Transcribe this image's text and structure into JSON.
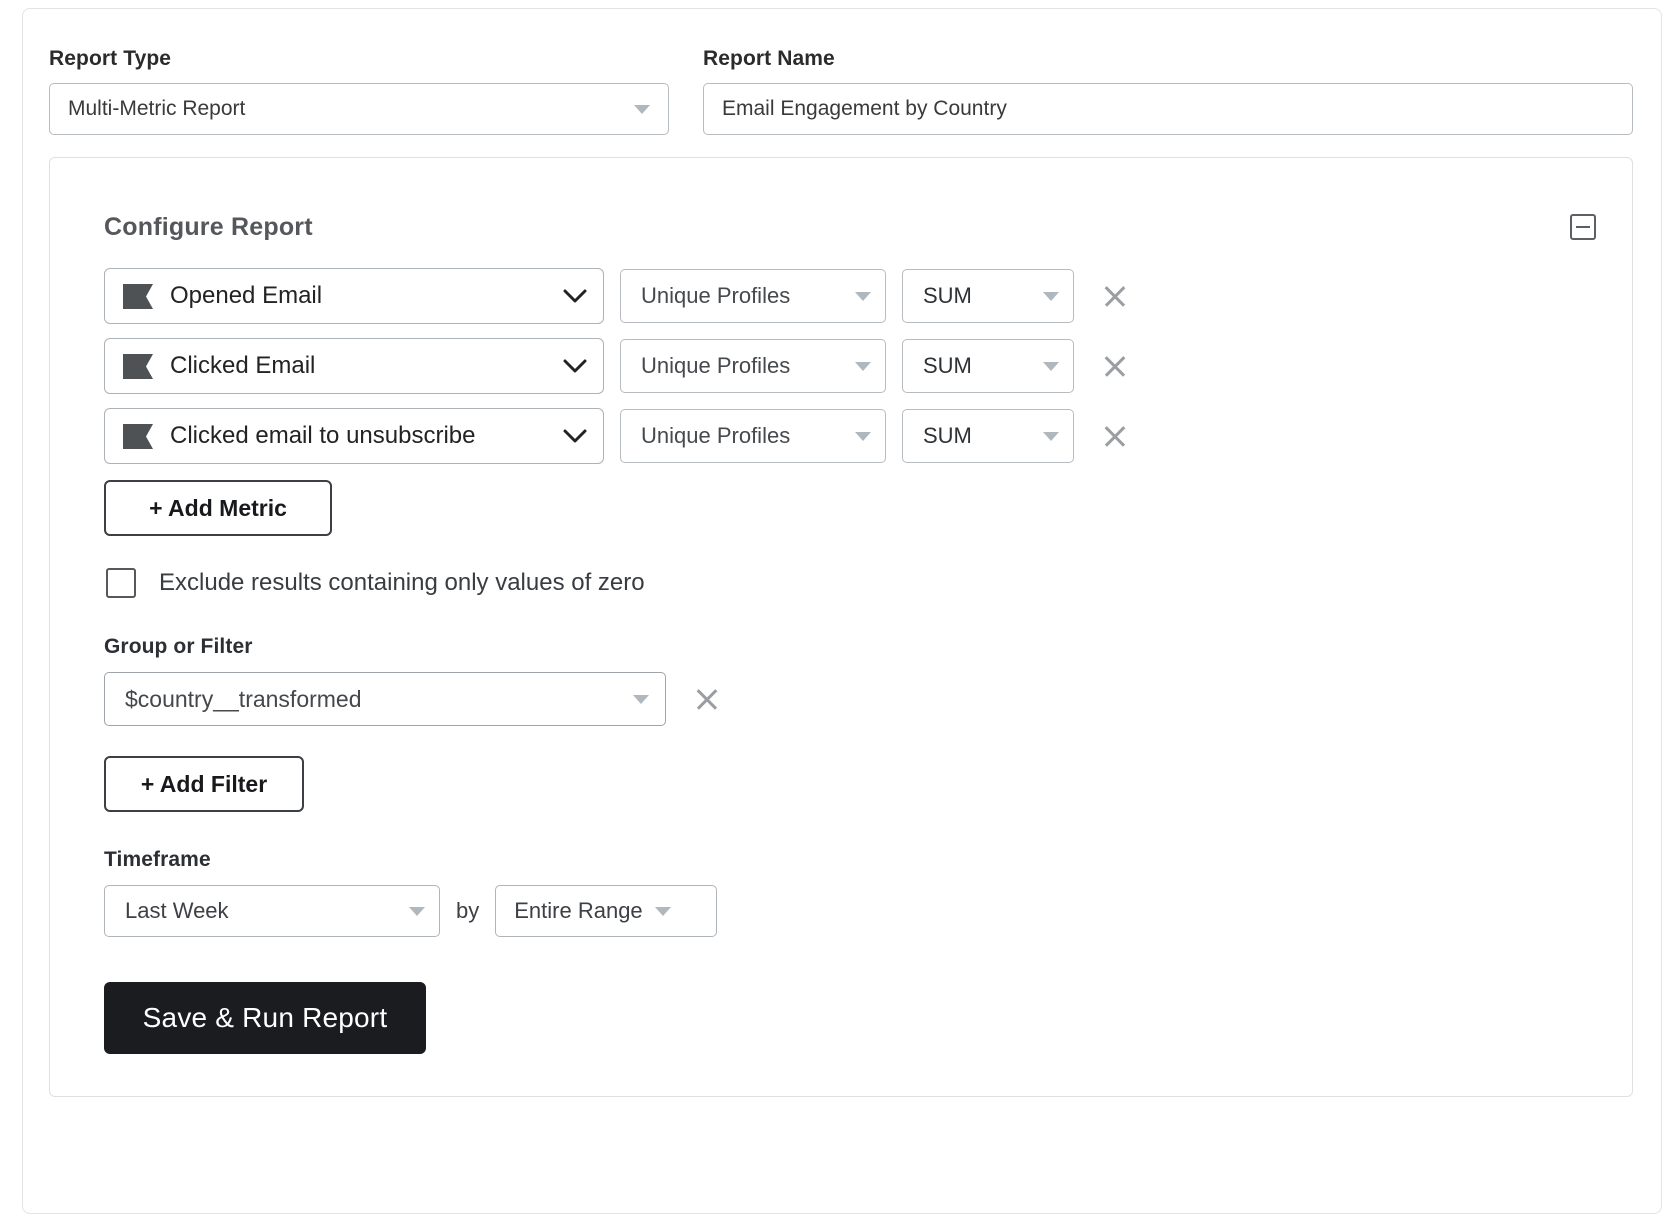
{
  "form": {
    "report_type": {
      "label": "Report Type",
      "value": "Multi-Metric Report"
    },
    "report_name": {
      "label": "Report Name",
      "value": "Email Engagement by Country",
      "placeholder": "Report Name"
    }
  },
  "panel": {
    "title": "Configure Report",
    "collapse_icon": "minus-square-icon"
  },
  "metrics": [
    {
      "icon": "flag-icon",
      "name": "Opened Email",
      "aggregation": "Unique Profiles",
      "operation": "SUM",
      "remove_icon": "close-icon"
    },
    {
      "icon": "flag-icon",
      "name": "Clicked Email",
      "aggregation": "Unique Profiles",
      "operation": "SUM",
      "remove_icon": "close-icon"
    },
    {
      "icon": "flag-icon",
      "name": "Clicked email to unsubscribe",
      "aggregation": "Unique Profiles",
      "operation": "SUM",
      "remove_icon": "close-icon"
    }
  ],
  "buttons": {
    "add_metric": "+ Add Metric",
    "add_filter": "+ Add Filter",
    "save_and_run": "Save & Run Report"
  },
  "exclude_zero": {
    "label": "Exclude results containing only values of zero",
    "checked": false
  },
  "group_or_filter": {
    "label": "Group or Filter",
    "value": "$country__transformed",
    "remove_icon": "close-icon"
  },
  "timeframe": {
    "label": "Timeframe",
    "range_value": "Last Week",
    "connector": "by",
    "interval_value": "Entire Range"
  },
  "colors": {
    "primary_button_bg": "#1a1c1f",
    "border": "#b7bcc0",
    "metric_icon": "#4f5255",
    "text": "#2b2b2b",
    "muted": "#9a9ea2"
  }
}
